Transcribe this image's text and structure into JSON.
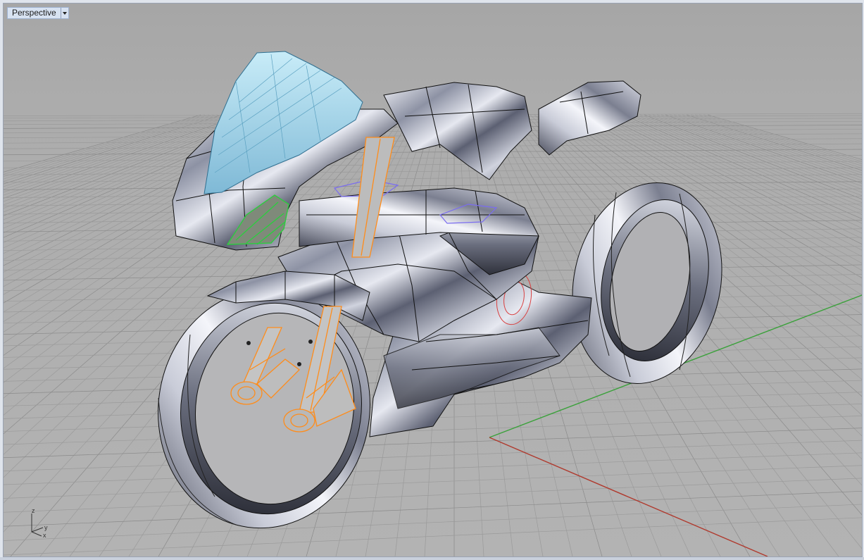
{
  "viewport": {
    "name": "Perspective",
    "menu_icon": "chevron-down-icon"
  },
  "axis_gizmo": {
    "z": "z",
    "y": "y",
    "x": "x"
  },
  "colors": {
    "background": "#a9a9a9",
    "grid_minor": "#b5b5b5",
    "grid_major": "#8f8f8f",
    "x_axis": "#b03a2e",
    "y_axis": "#3aa13a",
    "selection_orange": "#ff8c1a",
    "selection_green": "#2ecc40",
    "selection_red": "#d94040",
    "windscreen": "#9fd6ee",
    "wireframe": "#111111"
  },
  "model": {
    "object_type": "motorcycle-model",
    "render_mode": "rendered"
  }
}
